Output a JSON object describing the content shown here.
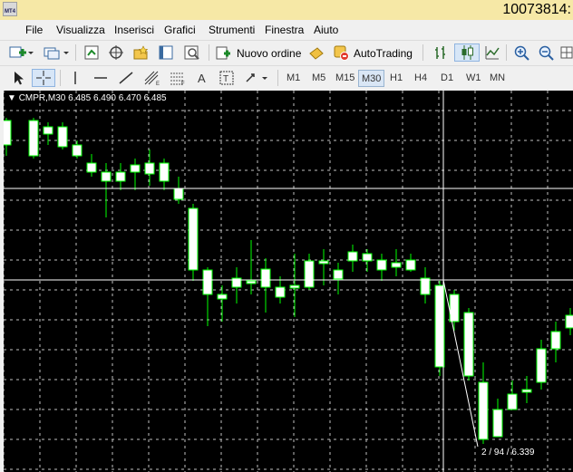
{
  "window": {
    "title": "10073814:",
    "app_icon_text": "MT4"
  },
  "menu": [
    "File",
    "Visualizza",
    "Inserisci",
    "Grafici",
    "Strumenti",
    "Finestra",
    "Aiuto"
  ],
  "toolbar1": {
    "new_order_label": "Nuovo ordine",
    "autotrading_label": "AutoTrading"
  },
  "timeframes": [
    "M1",
    "M5",
    "M15",
    "M30",
    "H1",
    "H4",
    "D1",
    "W1",
    "MN"
  ],
  "active_timeframe": "M30",
  "chart": {
    "symbol_label": "CMPR,M30",
    "ohlc_label": "6.485 6.490 6.470 6.485",
    "crosshair_readout": "2 / 94 / 6.339",
    "colors": {
      "background": "#000000",
      "grid": "#c0c0c0",
      "bull_body": "#ffffff",
      "wick": "#00ff00",
      "crosshair": "#ffffff"
    }
  }
}
